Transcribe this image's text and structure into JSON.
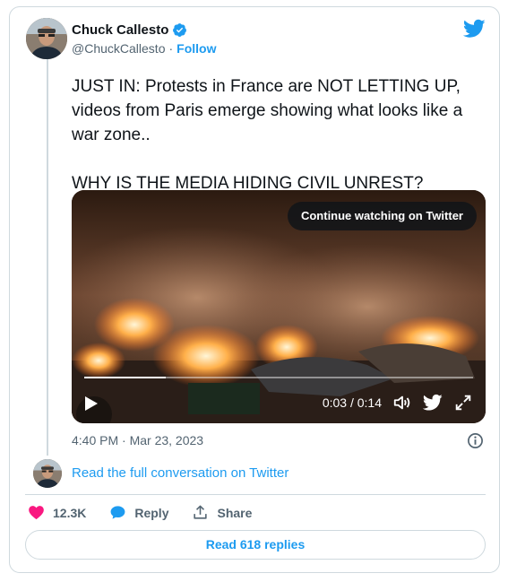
{
  "author": {
    "display_name": "Chuck Callesto",
    "handle": "@ChuckCallesto",
    "separator": "·",
    "follow_label": "Follow"
  },
  "tweet": {
    "paragraphs": [
      "JUST IN: Protests in France are NOT LETTING UP, videos from Paris emerge showing what looks like a war zone..",
      "WHY IS THE MEDIA HIDING CIVIL UNREST?"
    ],
    "timestamp": "4:40 PM · Mar 23, 2023"
  },
  "video": {
    "continue_label": "Continue watching on Twitter",
    "time_current": "0:03",
    "time_total": "0:14",
    "time_readout": "0:03 / 0:14",
    "progress_fraction": 0.21
  },
  "read_conversation": "Read the full conversation on Twitter",
  "actions": {
    "likes": "12.3K",
    "reply_label": "Reply",
    "share_label": "Share"
  },
  "read_replies_label": "Read 618 replies",
  "colors": {
    "accent": "#1d9bf0",
    "like": "#f91880",
    "secondary_text": "#536471",
    "border": "#cfd9de"
  },
  "icons": [
    "verified-badge-icon",
    "twitter-bird-icon",
    "play-icon",
    "volume-icon",
    "fullscreen-icon",
    "info-icon",
    "heart-icon",
    "reply-bubble-icon",
    "share-icon"
  ]
}
